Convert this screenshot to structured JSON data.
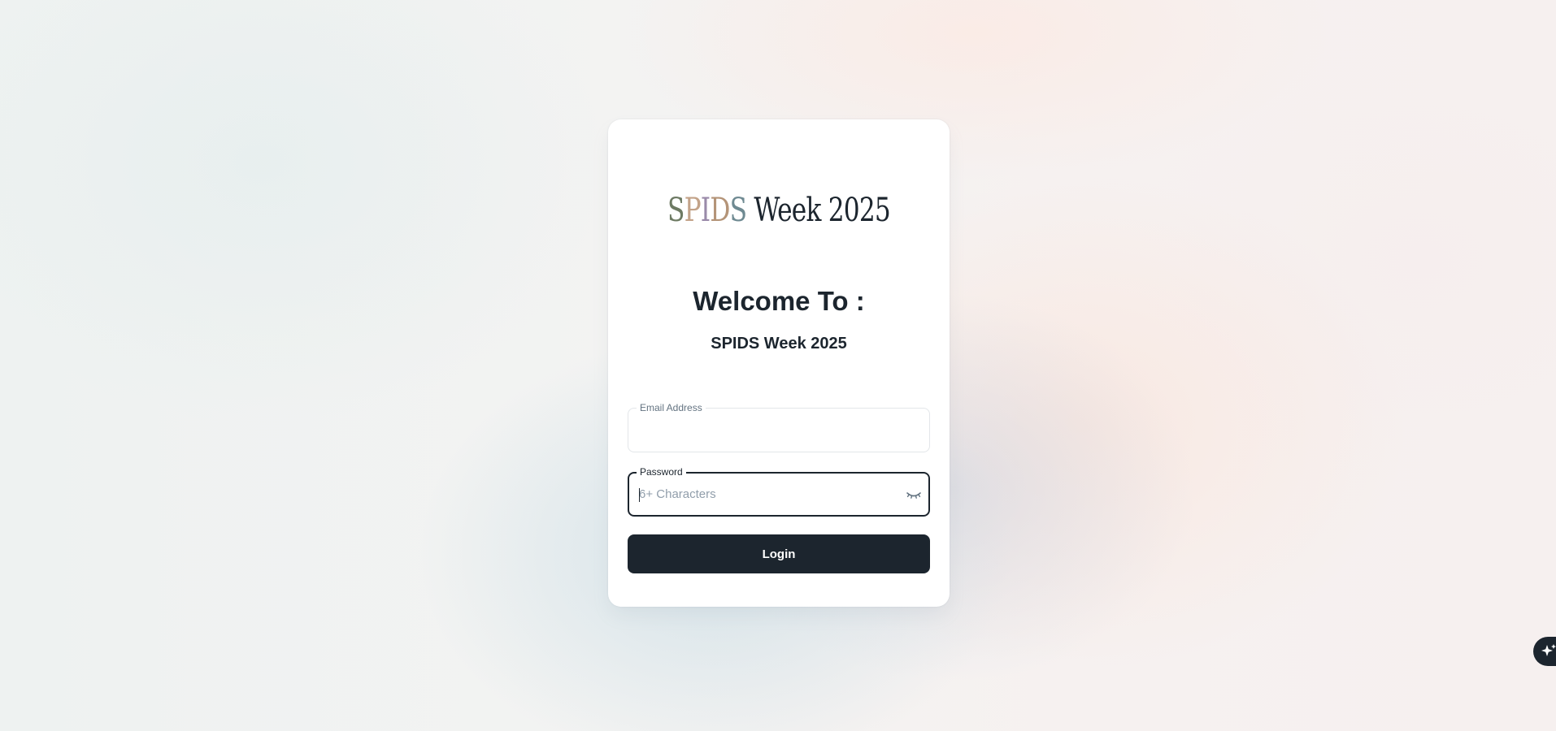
{
  "brand": {
    "logo_text": "SPIDS Week 2025",
    "logo_letters": [
      "S",
      "P",
      "I",
      "D",
      "S"
    ],
    "logo_rest": " Week 2025"
  },
  "heading": {
    "welcome": "Welcome To :",
    "event_name": "SPIDS Week 2025"
  },
  "form": {
    "email": {
      "label": "Email Address",
      "value": "",
      "placeholder": ""
    },
    "password": {
      "label": "Password",
      "value": "",
      "placeholder": "6+ Characters",
      "visibility_icon": "eye-closed-icon"
    },
    "login_label": "Login"
  },
  "floating_action": {
    "icon": "sparkle-icon"
  },
  "colors": {
    "primary": "#1c252e",
    "card": "#ffffff",
    "placeholder": "#919eab",
    "label": "#637381"
  }
}
